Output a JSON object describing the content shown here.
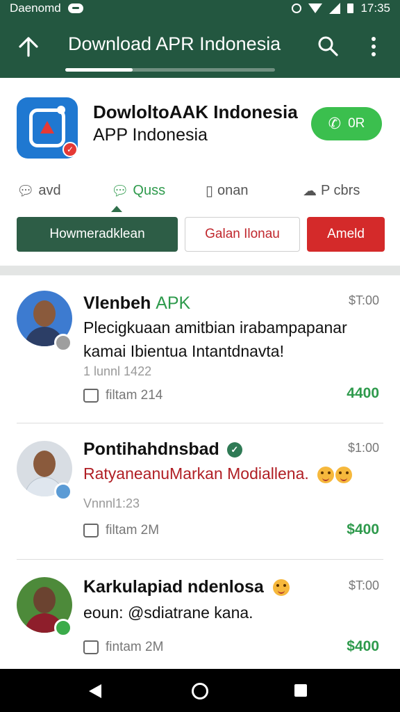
{
  "status_bar": {
    "title": "Daenomd",
    "time": "17:35"
  },
  "app_bar": {
    "title": "Download APR Indonesia",
    "up_icon": "home-up-arrow-icon",
    "search_icon": "search-icon",
    "more_icon": "more-vert-icon",
    "progress": 0.32
  },
  "app_card": {
    "name": "DowloltoAAK Indonesia",
    "subtitle": "APP Indonesia",
    "call_button": "0R",
    "tabs": [
      {
        "label": "avd",
        "icon": "chat-bubble-icon",
        "active": false
      },
      {
        "label": "Quss",
        "icon": "chat-bubble-icon",
        "active": true
      },
      {
        "label": "onan",
        "icon": "book-icon",
        "active": false
      },
      {
        "label": "P cbrs",
        "icon": "cloud-icon",
        "active": false
      }
    ],
    "buttons": {
      "primary": "Howmeradklean",
      "outline": "Galan Ilonau",
      "danger": "Ameld"
    }
  },
  "posts": [
    {
      "name": "Vlenbeh",
      "name_accent": "APK",
      "time": "$T:00",
      "text_line1": "Plecigkuaan amitbian irabampapanar",
      "text_line2": "kamai Ibientua Intantdnavta!",
      "meta": "1 lunnl 1422",
      "action": "filtam 214",
      "price": "4400",
      "badge_color": "#9e9e9e",
      "shirt_color": "#2c3e66"
    },
    {
      "name": "Pontihahdnsbad",
      "time": "$1:00",
      "text_line1": "RatyaneanuMarkan Modiallena.",
      "meta": "Vnnnl1:23",
      "action": "filtam 2M",
      "price": "$400",
      "badge_color": "#5b9bd5",
      "shirt_color": "#dfe6ee"
    },
    {
      "name": "Karkulapiad ndenlosa",
      "time": "$T:00",
      "text_line1": "eoun: @sdiatrane kana.",
      "action": "fintam 2M",
      "price": "$400",
      "badge_color": "#3bab4a",
      "shirt_color": "#8e1e2b"
    }
  ]
}
